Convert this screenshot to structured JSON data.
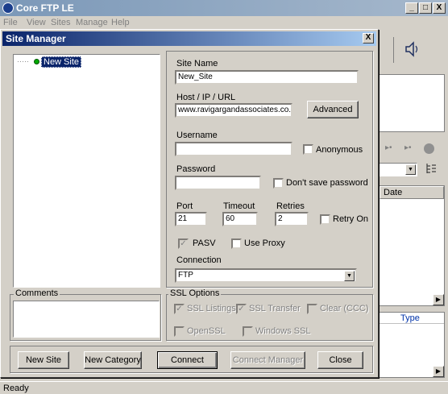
{
  "app": {
    "title": "Core FTP LE",
    "window_buttons": [
      "_",
      "□",
      "X"
    ],
    "menu": [
      "File",
      "View",
      "Sites",
      "Manage",
      "Help"
    ],
    "right_panel": {
      "date_header": "Date",
      "type_header": "Type",
      "play_icon": "▸•",
      "dropdown_arrow": "▼"
    },
    "status": "Ready"
  },
  "dialog": {
    "title": "Site Manager",
    "close": "X",
    "tree": {
      "expander": "·····",
      "node_label": "New Site"
    },
    "comments_label": "Comments",
    "site_name_label": "Site Name",
    "site_name_value": "New_Site",
    "host_label": "Host / IP / URL",
    "host_value": "www.ravigargandassociates.co.uk",
    "advanced_button": "Advanced",
    "username_label": "Username",
    "username_value": "",
    "anonymous_label": "Anonymous",
    "anonymous_checked": false,
    "password_label": "Password",
    "password_value": "",
    "dont_save_label": "Don't save password",
    "dont_save_checked": false,
    "port_label": "Port",
    "port_value": "21",
    "timeout_label": "Timeout",
    "timeout_value": "60",
    "retries_label": "Retries",
    "retries_value": "2",
    "retry_on_label": "Retry On",
    "retry_on_checked": false,
    "pasv_label": "PASV",
    "pasv_checked": true,
    "use_proxy_label": "Use Proxy",
    "use_proxy_checked": false,
    "connection_label": "Connection",
    "connection_value": "FTP",
    "ssl_options_label": "SSL Options",
    "ssl_listings_label": "SSL Listings",
    "ssl_listings_checked": true,
    "ssl_transfer_label": "SSL Transfer",
    "ssl_transfer_checked": true,
    "clear_ccc_label": "Clear (CCC)",
    "clear_ccc_checked": false,
    "openssl_label": "OpenSSL",
    "windows_ssl_label": "Windows SSL",
    "check_mark": "✓",
    "buttons": {
      "new_site": "New Site",
      "new_category": "New Category",
      "connect": "Connect",
      "connect_manager": "Connect Manager",
      "close": "Close"
    }
  }
}
